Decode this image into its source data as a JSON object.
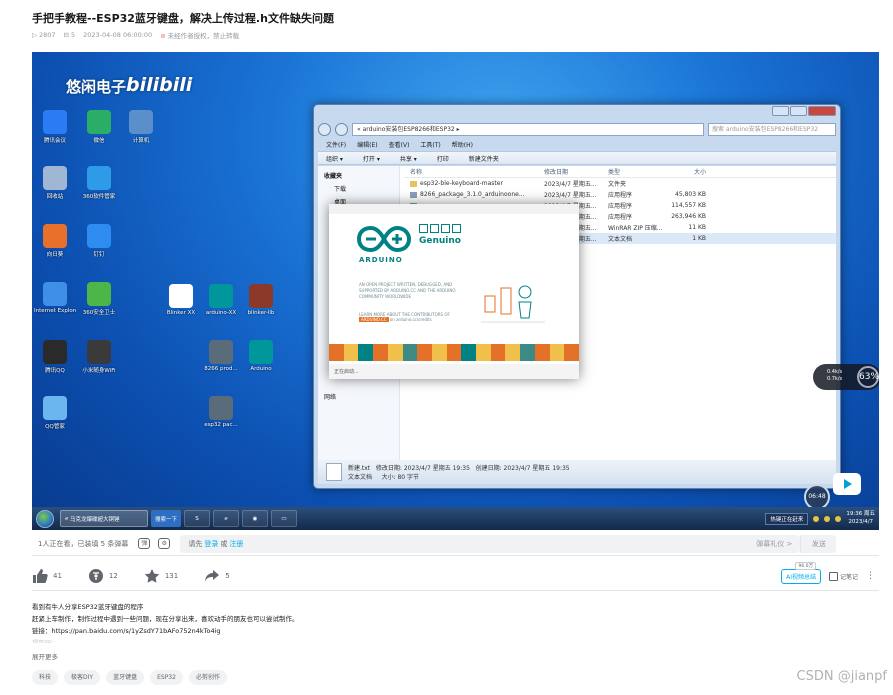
{
  "video": {
    "title": "手把手教程--ESP32蓝牙键盘，解决上传过程.h文件缺失问题",
    "meta": {
      "plays": "2807",
      "danmaku_count": "5",
      "date": "2023-04-08 06:00:00",
      "notice": "未经作者授权，禁止转载"
    }
  },
  "player": {
    "watermark": {
      "text": "悠闲电子",
      "brand": "bilibili"
    },
    "desktop_icons": [
      {
        "name": "腾讯会议",
        "color": "#2b7cf4"
      },
      {
        "name": "微信",
        "color": "#2aae67"
      },
      {
        "name": "计算机",
        "color": "#5b8fc9"
      },
      {
        "name": "回收站",
        "color": "#9fb7d3"
      },
      {
        "name": "360软件管家",
        "color": "#2e9be8"
      },
      {
        "name": "向日葵",
        "color": "#e8702a"
      },
      {
        "name": "钉钉",
        "color": "#2e8cf0"
      },
      {
        "name": "Internet Explorer",
        "color": "#3f8fe6"
      },
      {
        "name": "360安全卫士",
        "color": "#4cb748"
      },
      {
        "name": "腾讯QQ",
        "color": "#2a2a2a"
      },
      {
        "name": "小米随身WiFi",
        "color": "#3a3a3a"
      },
      {
        "name": "QQ管家",
        "color": "#6cb6f0"
      },
      {
        "name": "Blinker XX",
        "color": "#ffffff"
      },
      {
        "name": "arduino-XX",
        "color": "#00979c"
      },
      {
        "name": "blinker-lib",
        "color": "#8b3a2a"
      },
      {
        "name": "8266 prod...",
        "color": "#5a6b7a"
      },
      {
        "name": "Arduino",
        "color": "#00979c"
      },
      {
        "name": "esp32 pac...",
        "color": "#5a6b7a"
      }
    ],
    "explorer": {
      "address": "« arduino安装包ESP8266和ESP32 ▸",
      "search_placeholder": "搜索 arduino安装包ESP8266和ESP32",
      "menu": [
        "文件(F)",
        "编辑(E)",
        "查看(V)",
        "工具(T)",
        "帮助(H)"
      ],
      "toolbar": [
        "组织 ▾",
        "打开 ▾",
        "共享 ▾",
        "打印",
        "新建文件夹"
      ],
      "nav_pane": {
        "favorites": "收藏夹",
        "items": [
          "下载",
          "桌面"
        ],
        "network": "网络"
      },
      "columns": [
        "名称",
        "修改日期",
        "类型",
        "大小"
      ],
      "files": [
        {
          "name": "esp32-ble-keyboard-master",
          "date": "2023/4/7 星期五...",
          "type": "文件夹",
          "size": ""
        },
        {
          "name": "8266_package_3.1.0_arduinoone...",
          "date": "2023/4/7 星期五...",
          "type": "应用程序",
          "size": "45,803 KB"
        },
        {
          "name": "",
          "date": "2023/4/7 星期五...",
          "type": "应用程序",
          "size": "114,557 KB"
        },
        {
          "name": "",
          "date": "2023/4/7 星期五...",
          "type": "应用程序",
          "size": "263,946 KB"
        },
        {
          "name": "",
          "date": "2023/4/7 星期五...",
          "type": "WinRAR ZIP 压缩...",
          "size": "11 KB"
        },
        {
          "name": "",
          "date": "2023/4/7 星期五...",
          "type": "文本文档",
          "size": "1 KB"
        }
      ],
      "details": {
        "name": "新建.txt",
        "modified": "修改日期: 2023/4/7 星期五 19:35",
        "created": "创建日期: 2023/4/7 星期五 19:35",
        "type": "文本文档",
        "size": "大小: 80 字节"
      }
    },
    "splash": {
      "brand": "ARDUINO",
      "sub": "Genuino",
      "text": "AN OPEN PROJECT WRITTEN, DEBUGGED, AND SUPPORTED BY ARDUINO.CC AND THE ARDUINO COMMUNITY WORLDWIDE",
      "learn": "LEARN MORE ABOUT THE CONTRIBUTORS OF",
      "highlight": "ARDUINO.CC",
      "site": "on arduino.cc/credits",
      "status": "正在启动...",
      "strip_colors": [
        "#e47128",
        "#f1c04b",
        "#008184",
        "#e47128",
        "#f1c04b",
        "#3d8a85",
        "#e47128",
        "#f1c04b",
        "#e47128",
        "#008184",
        "#f1c04b",
        "#e47128",
        "#f1c04b",
        "#3d8a85",
        "#e47128",
        "#f1c04b",
        "#e47128"
      ]
    },
    "taskbar": {
      "ie_task": "马克龙爆碟超大铜锤",
      "search_task": "搜索一下",
      "tray_label": "热键正在赶来",
      "time": "19:36 周五",
      "date": "2023/4/7"
    },
    "overlay": {
      "speed_up": "0.4k/s",
      "speed_down": "0.7k/s",
      "cpu": "63%",
      "timer": "06:48"
    }
  },
  "danmaku_bar": {
    "viewers": "1人正在看，已装填 5 条弹幕",
    "input_prefix": "请先",
    "login": "登录",
    "or": "或",
    "register": "注册",
    "etiquette": "弹幕礼仪 >",
    "send": "发送"
  },
  "actions": {
    "like": "41",
    "coin": "12",
    "favorite": "131",
    "share": "5",
    "ai_summary": "AI视频总结",
    "ai_badge": "96.0万",
    "note": "记笔记",
    "more": "⋮"
  },
  "description": {
    "lines": [
      "看到有牛人分享ESP32蓝牙键盘的程序",
      "赶紧上车制作，制作过程中遇到一些问题，现在分享出来，喜欢动手的朋友也可以尝试制作。",
      "链接：https://pan.baidu.com/s/1yZsdY71bAFo752n4kTo4ig"
    ],
    "truncated": "提取码：…",
    "expand": "展开更多"
  },
  "tags": [
    "科技",
    "极客DIY",
    "蓝牙键盘",
    "ESP32",
    "必剪创作"
  ],
  "watermark_footer": "CSDN @jianpf"
}
